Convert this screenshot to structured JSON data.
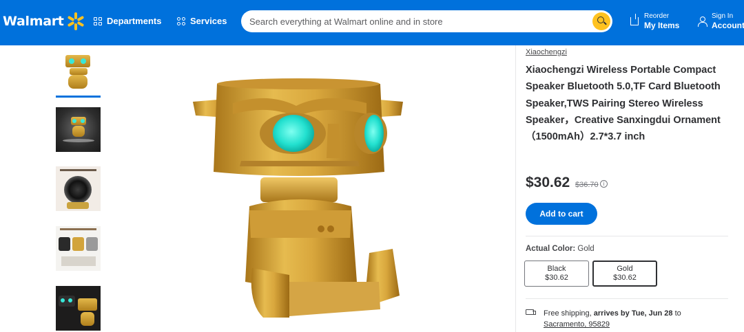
{
  "header": {
    "logo": "Walmart",
    "departments": "Departments",
    "services": "Services",
    "search_placeholder": "Search everything at Walmart online and in store",
    "reorder_small": "Reorder",
    "reorder_big": "My Items",
    "signin_small": "Sign In",
    "signin_big": "Account",
    "colors": {
      "bar": "#0071dc",
      "spark": "#ffc220"
    }
  },
  "gallery": {
    "thumbnails": [
      "thumb-1",
      "thumb-2",
      "thumb-3",
      "thumb-4",
      "thumb-5"
    ],
    "selected_index": 0,
    "main_image": "gold Sanxingdui bronze-mask figure speaker with glowing cyan eyes"
  },
  "product": {
    "brand": "Xiaochengzi",
    "title": "Xiaochengzi Wireless Portable Compact Speaker Bluetooth 5.0,TF Card Bluetooth Speaker,TWS Pairing Stereo Wireless Speaker，Creative Sanxingdui Ornament（1500mAh）2.7*3.7 inch",
    "price": "$30.62",
    "was_price": "$36.70",
    "add_to_cart": "Add to cart",
    "color_label": "Actual Color:",
    "color_value": "Gold",
    "options": [
      {
        "name": "Black",
        "price": "$30.62"
      },
      {
        "name": "Gold",
        "price": "$30.62"
      }
    ],
    "shipping": {
      "prefix": "Free shipping,",
      "arrives": "arrives by Tue, Jun 28",
      "to": "to",
      "location": "Sacramento, 95829"
    }
  }
}
